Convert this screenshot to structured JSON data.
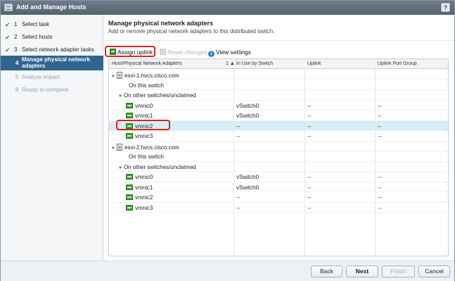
{
  "window": {
    "title": "Add and Manage Hosts",
    "help_glyph": "?"
  },
  "steps": [
    {
      "number": "1",
      "label": "Select task",
      "state": "done"
    },
    {
      "number": "2",
      "label": "Select hosts",
      "state": "done"
    },
    {
      "number": "3",
      "label": "Select network adapter tasks",
      "state": "done"
    },
    {
      "number": "4",
      "label": "Manage physical network adapters",
      "state": "active"
    },
    {
      "number": "5",
      "label": "Analyze impact",
      "state": "todo"
    },
    {
      "number": "6",
      "label": "Ready to complete",
      "state": "todo"
    }
  ],
  "page": {
    "heading": "Manage physical network adapters",
    "subheading": "Add or remove physical network adapters to this distributed switch."
  },
  "toolbar": {
    "assign_label": "Assign uplink",
    "reset_label": "Reset changes",
    "view_label": "View settings",
    "info_glyph": "i"
  },
  "table": {
    "columns": [
      "Host/Physical Network Adapters",
      "In Use by Switch",
      "Uplink",
      "Uplink Port Group"
    ],
    "sort_indicator": "1 ▲",
    "rows": [
      {
        "kind": "host",
        "name": "esxi-1.hvcs.cisco.com",
        "in_use": "",
        "uplink": "",
        "group": ""
      },
      {
        "kind": "group",
        "name": "On this switch",
        "in_use": "",
        "uplink": "",
        "group": ""
      },
      {
        "kind": "group",
        "name": "On other switches/unclaimed",
        "in_use": "",
        "uplink": "",
        "group": ""
      },
      {
        "kind": "nic",
        "name": "vmnic0",
        "in_use": "vSwitch0",
        "uplink": "--",
        "group": "--"
      },
      {
        "kind": "nic",
        "name": "vmnic1",
        "in_use": "vSwitch0",
        "uplink": "--",
        "group": "--"
      },
      {
        "kind": "nic",
        "name": "vmnic2",
        "in_use": "--",
        "uplink": "--",
        "group": "--",
        "selected": true
      },
      {
        "kind": "nic",
        "name": "vmnic3",
        "in_use": "--",
        "uplink": "--",
        "group": "--"
      },
      {
        "kind": "host",
        "name": "esxi-2.hvcs.cisco.com",
        "in_use": "",
        "uplink": "",
        "group": ""
      },
      {
        "kind": "group",
        "name": "On this switch",
        "in_use": "",
        "uplink": "",
        "group": ""
      },
      {
        "kind": "group",
        "name": "On other switches/unclaimed",
        "in_use": "",
        "uplink": "",
        "group": ""
      },
      {
        "kind": "nic",
        "name": "vmnic0",
        "in_use": "vSwitch0",
        "uplink": "--",
        "group": "--"
      },
      {
        "kind": "nic",
        "name": "vmnic1",
        "in_use": "vSwitch0",
        "uplink": "--",
        "group": "--"
      },
      {
        "kind": "nic",
        "name": "vmnic2",
        "in_use": "--",
        "uplink": "--",
        "group": "--"
      },
      {
        "kind": "nic",
        "name": "vmnic3",
        "in_use": "--",
        "uplink": "--",
        "group": "--"
      }
    ]
  },
  "footer": {
    "back_label": "Back",
    "next_label": "Next",
    "finish_label": "Finish",
    "cancel_label": "Cancel"
  },
  "colors": {
    "active_step": "#30658f",
    "highlight_box": "#d9261c",
    "selected_row": "#d8ecf8"
  }
}
